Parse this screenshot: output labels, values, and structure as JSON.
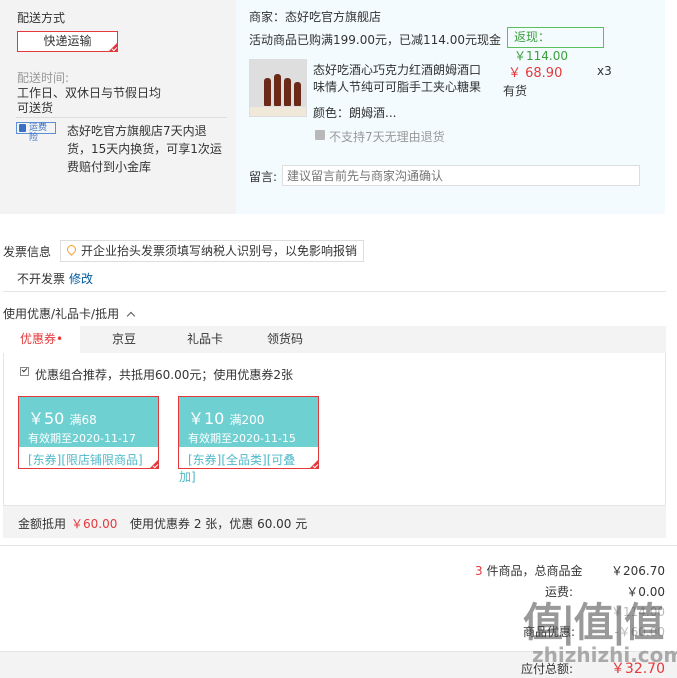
{
  "shipping": {
    "heading": "配送方式",
    "method": "快递运输",
    "time_label": "配送时间:",
    "time_value_line1": "工作日、双休日与节假日均",
    "time_value_line2": "可送货",
    "insurance_icon_text": "运费险",
    "insurance_line1": "态好吃官方旗舰店7天内退",
    "insurance_line2": "货，15天内换货，可享1次运",
    "insurance_line3": "费赔付到小金库"
  },
  "store": {
    "name": "商家：态好吃官方旗舰店",
    "promo": "活动商品已购满199.00元，已减114.00元现金",
    "cashback": "返现：￥114.00",
    "product": {
      "title_line1": "态好吃酒心巧克力红酒朗姆酒口",
      "title_line2": "味情人节纯可可脂手工夹心糖果",
      "price": "￥ 68.90",
      "quantity": "x3",
      "stock": "有货",
      "color": "颜色：朗姆酒...",
      "return_policy": "不支持7天无理由退货"
    },
    "message_label": "留言:",
    "message_placeholder": "建议留言前先与商家沟通确认"
  },
  "invoice": {
    "heading": "发票信息",
    "tip": "开企业抬头发票须填写纳税人识别号，以免影响报销",
    "status": "不开发票",
    "edit_link": "修改"
  },
  "discounts": {
    "heading": "使用优惠/礼品卡/抵用",
    "tabs": [
      "优惠券•",
      "京豆",
      "礼品卡",
      "领货码"
    ],
    "recommend": "优惠组合推荐，共抵用60.00元；使用优惠券2张",
    "coupons": [
      {
        "amount": "￥50",
        "threshold": "满68",
        "valid": "有效期至2020-11-17",
        "scope": "[东券][限店铺限商品]"
      },
      {
        "amount": "￥10",
        "threshold": "满200",
        "valid": "有效期至2020-11-15",
        "scope": "[东券][全品类][可叠",
        "scope_overflow": "加]"
      }
    ],
    "summary_label": "金额抵用",
    "summary_amount": "￥60.00",
    "summary_detail": "使用优惠券 2 张，优惠 60.00 元"
  },
  "totals": {
    "count": "3",
    "goods_label": "件商品，总商品金",
    "goods_value": "￥206.70",
    "shipping_label": "运费:",
    "shipping_value": "￥0.00",
    "row3_value": "￥114.00",
    "row4_label": "商品优惠:",
    "row4_value": "-￥60.00",
    "payable_label": "应付总额:",
    "payable_value": "￥32.70"
  },
  "watermark": {
    "logo": "值|值|值",
    "url": "zhizhizhi.com"
  },
  "colors": {
    "accent_red": "#e4393c",
    "coupon_teal": "#6fd0d2",
    "cashback_green": "#3ca13c",
    "link_blue": "#005aa0"
  },
  "icons": [
    "check-corner-icon",
    "shield-icon",
    "location-pin-icon",
    "chevron-up-icon",
    "no-return-icon",
    "checkbox-icon"
  ]
}
